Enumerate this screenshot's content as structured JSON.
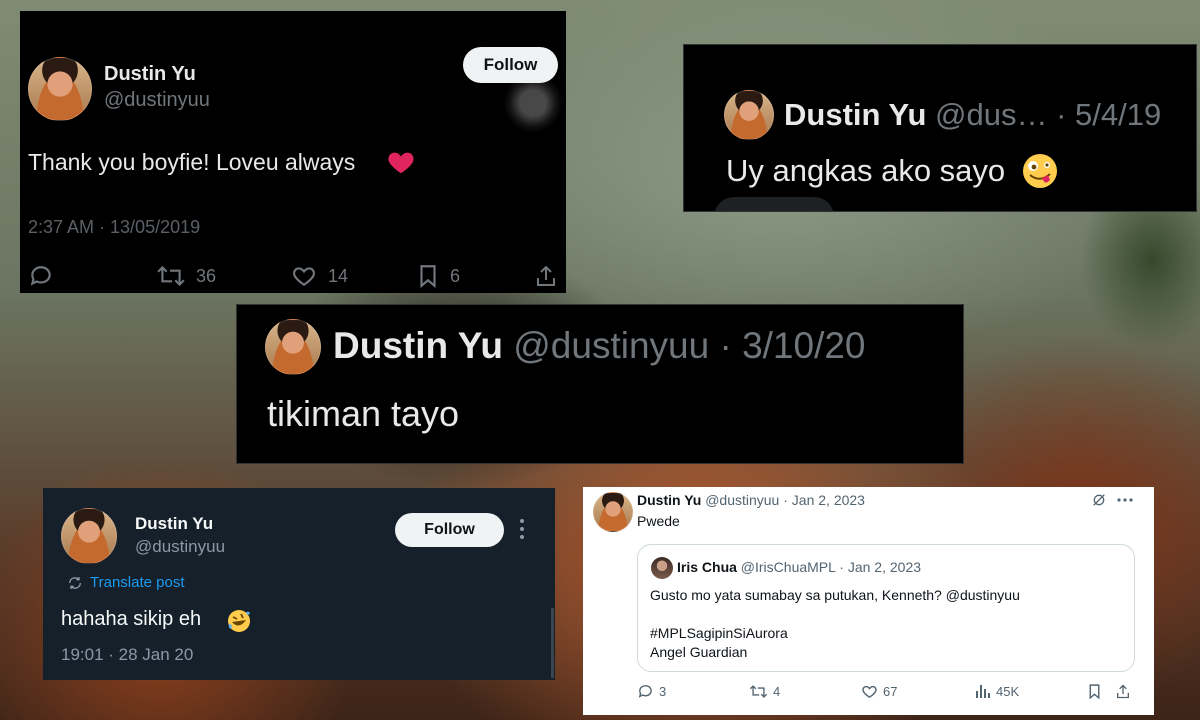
{
  "card1": {
    "name": "Dustin Yu",
    "handle": "@dustinyuu",
    "follow_label": "Follow",
    "text": "Thank you boyfie! Loveu always",
    "timestamp": "2:37 AM · 13/05/2019",
    "retweets": "36",
    "likes": "14",
    "bookmarks": "6"
  },
  "card2": {
    "name": "Dustin Yu",
    "handle_date": "@dus… · 5/4/19",
    "text": "Uy angkas ako sayo"
  },
  "card3": {
    "name": "Dustin Yu",
    "handle_date": "@dustinyuu · 3/10/20",
    "text": "tikiman tayo"
  },
  "card4": {
    "name": "Dustin Yu",
    "handle": "@dustinyuu",
    "follow_label": "Follow",
    "translate_label": "Translate post",
    "text": "hahaha sikip eh",
    "timestamp": "19:01 · 28 Jan 20"
  },
  "card5": {
    "name": "Dustin Yu",
    "handle_date": "@dustinyuu · Jan 2, 2023",
    "text": "Pwede",
    "quote": {
      "name": "Iris Chua",
      "handle_date": "@IrisChuaMPL · Jan 2, 2023",
      "text": "Gusto mo yata sumabay sa putukan, Kenneth? @dustinyuu",
      "hashtag": "#MPLSagipinSiAurora",
      "line3": "Angel Guardian"
    },
    "replies": "3",
    "retweets": "4",
    "likes": "67",
    "views": "45K"
  },
  "colors": {
    "x_blue": "#1d9bf0",
    "heart_red": "#e0245e",
    "dim_gray": "#71767b"
  }
}
